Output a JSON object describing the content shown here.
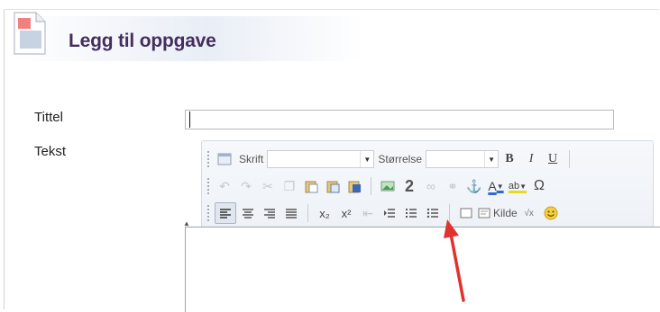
{
  "page": {
    "title": "Legg til oppgave",
    "colors": {
      "title": "#452d5e",
      "annotation_arrow": "#e0332f"
    }
  },
  "form": {
    "title_label": "Tittel",
    "title_value": "",
    "text_label": "Tekst"
  },
  "toolbar": {
    "row1": {
      "font_label": "Skrift",
      "font_value": "",
      "size_label": "Størrelse",
      "size_value": "",
      "bold": "B",
      "italic": "I",
      "underline": "U"
    },
    "row2": {
      "icons": [
        "undo-icon",
        "redo-icon",
        "cut-icon",
        "copy-icon",
        "paste-icon",
        "paste-text-icon",
        "paste-word-icon",
        "image-icon",
        "math-formula-icon",
        "link-icon",
        "unlink-icon",
        "anchor-icon",
        "text-color-icon",
        "background-color-icon",
        "special-char-icon"
      ],
      "text_color_glyph": "A",
      "bg_color_glyph": "ab",
      "special_char_glyph": "Ω"
    },
    "row3": {
      "subscript": "x₂",
      "superscript": "x²",
      "source_label": "Kilde"
    }
  }
}
